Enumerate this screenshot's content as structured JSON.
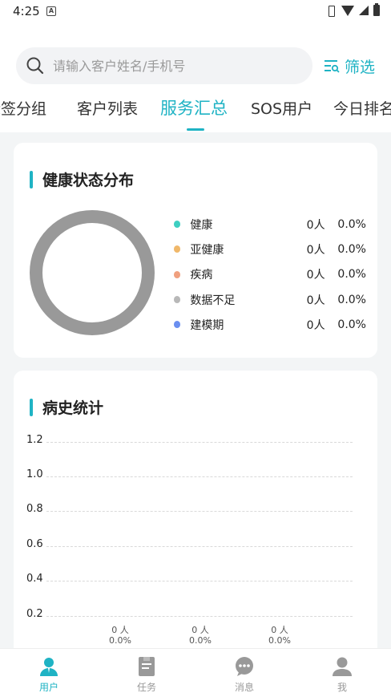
{
  "status": {
    "time": "4:25",
    "notif_glyph": "A"
  },
  "search": {
    "placeholder": "请输入客户姓名/手机号"
  },
  "filter": {
    "label": "筛选"
  },
  "tabs": [
    {
      "label": "标签分组"
    },
    {
      "label": "客户列表"
    },
    {
      "label": "服务汇总",
      "active": true
    },
    {
      "label": "SOS用户"
    },
    {
      "label": "今日排名"
    }
  ],
  "health": {
    "title": "健康状态分布",
    "items": [
      {
        "label": "健康",
        "count": "0人",
        "pct": "0.0%",
        "color": "#3ecfc1"
      },
      {
        "label": "亚健康",
        "count": "0人",
        "pct": "0.0%",
        "color": "#f0b86a"
      },
      {
        "label": "疾病",
        "count": "0人",
        "pct": "0.0%",
        "color": "#f0a07f"
      },
      {
        "label": "数据不足",
        "count": "0人",
        "pct": "0.0%",
        "color": "#b8b8b8"
      },
      {
        "label": "建模期",
        "count": "0人",
        "pct": "0.0%",
        "color": "#6a8ff0"
      }
    ],
    "donut_color": "#999999"
  },
  "history": {
    "title": "病史统计"
  },
  "chart_data": {
    "type": "bar",
    "title": "病史统计",
    "yticks": [
      "1.2",
      "1.0",
      "0.8",
      "0.6",
      "0.4",
      "0.2"
    ],
    "ylim": [
      0,
      1.2
    ],
    "grid": true,
    "values": [
      0,
      0,
      0
    ],
    "labels": [
      {
        "count": "0 人",
        "pct": "0.0%"
      },
      {
        "count": "0 人",
        "pct": "0.0%"
      },
      {
        "count": "0 人",
        "pct": "0.0%"
      }
    ]
  },
  "nav": [
    {
      "label": "用户",
      "icon": "user-icon",
      "active": true
    },
    {
      "label": "任务",
      "icon": "task-icon"
    },
    {
      "label": "消息",
      "icon": "message-icon"
    },
    {
      "label": "我",
      "icon": "profile-icon"
    }
  ],
  "colors": {
    "accent": "#1fb3c4",
    "background": "#f3f5f6"
  }
}
